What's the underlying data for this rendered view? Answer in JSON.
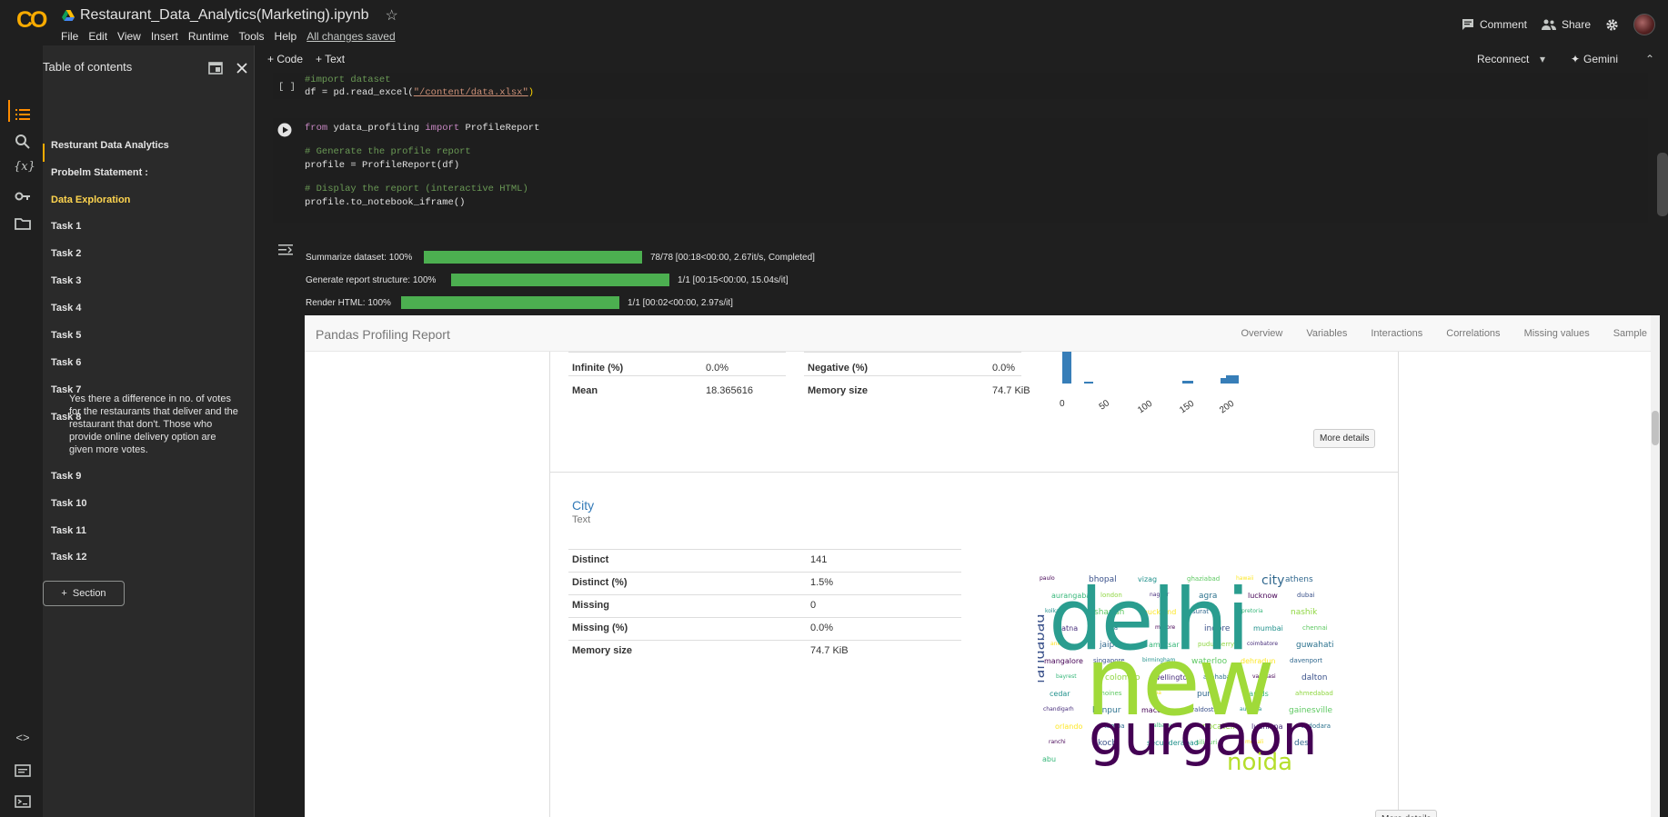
{
  "topbar": {
    "title": "Restaurant_Data_Analytics(Marketing).ipynb",
    "menus": [
      "File",
      "Edit",
      "View",
      "Insert",
      "Runtime",
      "Tools",
      "Help"
    ],
    "saved_status": "All changes saved",
    "comment": "Comment",
    "share": "Share"
  },
  "toc": {
    "title": "Table of contents",
    "items": [
      "Resturant Data Analytics",
      "Probelm Statement :",
      "Data Exploration",
      "Task 1",
      "Task 2",
      "Task 3",
      "Task 4",
      "Task 5",
      "Task 6",
      "Task 7",
      "Task 8"
    ],
    "desc": "Yes there a difference in no. of votes for the restaurants that deliver and the restaurant that don't. Those who provide online delivery option are given more votes.",
    "items2": [
      "Task 9",
      "Task 10",
      "Task 11",
      "Task 12"
    ],
    "section": "Section"
  },
  "cellbar": {
    "code": "+ Code",
    "text": "+ Text",
    "reconnect": "Reconnect",
    "gemini": "Gemini"
  },
  "cell1": {
    "run": "[ ]",
    "l1": "#import dataset",
    "l2a": "df = pd.read_excel(",
    "l2b": "\"/content/data.xlsx\"",
    "l2c": ")"
  },
  "cell2": {
    "l1a": "from",
    "l1b": " ydata_profiling ",
    "l1c": "import",
    "l1d": " ProfileReport",
    "l2": "# Generate the profile report",
    "l3": "profile = ProfileReport(df)",
    "l4": "# Display the report (interactive HTML)",
    "l5": "profile.to_notebook_iframe()"
  },
  "progress": [
    {
      "label": "Summarize dataset: 100%",
      "stats": "78/78 [00:18<00:00,   2.67it/s,  Completed]"
    },
    {
      "label": "Generate report structure: 100%",
      "stats": "1/1 [00:15<00:00, 15.04s/it]"
    },
    {
      "label": "Render HTML: 100%",
      "stats": "1/1 [00:02<00:00,   2.97s/it]"
    }
  ],
  "report": {
    "brand": "Pandas Profiling Report",
    "nav": [
      "Overview",
      "Variables",
      "Interactions",
      "Correlations",
      "Missing values",
      "Sample"
    ],
    "top_stats_left": [
      [
        "Infinite (%)",
        "0.0%"
      ],
      [
        "Mean",
        "18.365616"
      ]
    ],
    "top_stats_right": [
      [
        "Negative (%)",
        "0.0%"
      ],
      [
        "Memory size",
        "74.7 KiB"
      ]
    ],
    "hist_ticks": [
      "0",
      "50",
      "100",
      "150",
      "200"
    ],
    "more_details": "More details",
    "city_title": "City",
    "city_type": "Text",
    "city_stats": [
      [
        "Distinct",
        "141"
      ],
      [
        "Distinct (%)",
        "1.5%"
      ],
      [
        "Missing",
        "0"
      ],
      [
        "Missing (%)",
        "0.0%"
      ],
      [
        "Memory size",
        "74.7 KiB"
      ]
    ],
    "wordcloud": {
      "big": [
        "delhi",
        "new",
        "gurgaon",
        "noida",
        "faridabad",
        "city"
      ],
      "small": [
        "paulo",
        "bhopal",
        "vizag",
        "ghaziabad",
        "hawaii",
        "athens",
        "aurangabad",
        "london",
        "nagpur",
        "agra",
        "lucknow",
        "dubai",
        "kolkata",
        "sharjah",
        "auckland",
        "surat",
        "pretoria",
        "nashik",
        "patna",
        "goa",
        "mysore",
        "indore",
        "mumbai",
        "chennai",
        "ankara",
        "jaipur",
        "amritsar",
        "puducherry",
        "coimbatore",
        "guwahati",
        "mangalore",
        "singapore",
        "birmingham",
        "waterloo",
        "dehradun",
        "davenport",
        "bayrest",
        "colombo",
        "wellington",
        "allahabad",
        "varanasi",
        "dalton",
        "cedar",
        "moines",
        "doha",
        "pune",
        "rapids",
        "ahmedabad",
        "chandigarh",
        "kanpur",
        "macon",
        "valdosta",
        "augusta",
        "gainesville",
        "orlando",
        "tampa",
        "albany",
        "pocatello",
        "ludhiana",
        "vadodara",
        "ranchi",
        "kochi",
        "secunderabad",
        "siliguri",
        "mohali",
        "des",
        "abu"
      ]
    }
  }
}
